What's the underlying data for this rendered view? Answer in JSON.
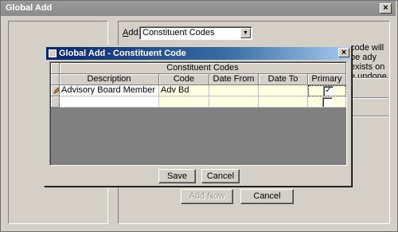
{
  "outer_window": {
    "title": "Global Add",
    "close_label": "×",
    "add_label_prefix": "A",
    "add_label_rest": "dd:",
    "add_select_value": "Constituent Codes",
    "info_text": "code will be ady exists on e undone.",
    "add_now_label": "Add Now",
    "cancel_label": "Cancel"
  },
  "dialog": {
    "title": "Global Add - Constituent Code",
    "close_label": "×",
    "group_header": "Constituent Codes",
    "columns": [
      "Description",
      "Code",
      "Date From",
      "Date To",
      "Primary"
    ],
    "rows": [
      {
        "description": "Advisory Board Member",
        "code": "Adv Bd",
        "date_from": "",
        "date_to": "",
        "primary": true
      },
      {
        "description": "",
        "code": "",
        "date_from": "",
        "date_to": "",
        "primary": false
      }
    ],
    "save_label": "Save",
    "cancel_label": "Cancel"
  },
  "colors": {
    "title_active": "#0a246a",
    "title_inactive": "#8a8a8a",
    "face": "#d4d0c8",
    "cell_highlight": "#ffffe1"
  }
}
